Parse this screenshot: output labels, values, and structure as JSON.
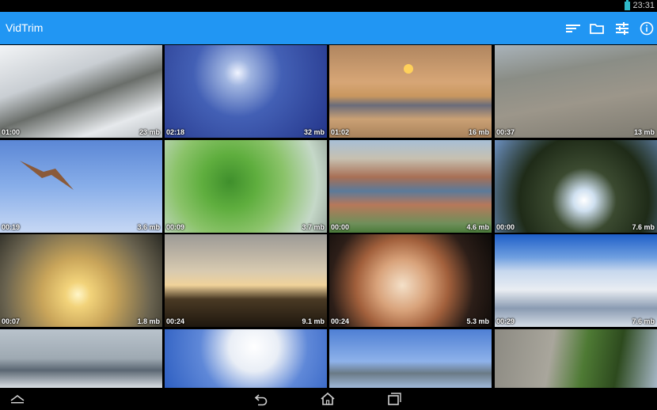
{
  "status_bar": {
    "time": "23:31"
  },
  "app_bar": {
    "title": "VidTrim",
    "actions": [
      "sort-icon",
      "folder-icon",
      "filter-settings-icon",
      "info-icon"
    ]
  },
  "videos": [
    {
      "duration": "01:00",
      "size": "23 mb"
    },
    {
      "duration": "02:18",
      "size": "32 mb"
    },
    {
      "duration": "01:02",
      "size": "16 mb"
    },
    {
      "duration": "00:37",
      "size": "13 mb"
    },
    {
      "duration": "00:19",
      "size": "3.6 mb"
    },
    {
      "duration": "00:09",
      "size": "3.7 mb"
    },
    {
      "duration": "00:00",
      "size": "4.6 mb"
    },
    {
      "duration": "00:00",
      "size": "7.6 mb"
    },
    {
      "duration": "00:07",
      "size": "1.8 mb"
    },
    {
      "duration": "00:24",
      "size": "9.1 mb"
    },
    {
      "duration": "00:24",
      "size": "5.3 mb"
    },
    {
      "duration": "00:29",
      "size": "7.6 mb"
    },
    {
      "duration": "",
      "size": ""
    },
    {
      "duration": "",
      "size": ""
    },
    {
      "duration": "",
      "size": ""
    },
    {
      "duration": "",
      "size": ""
    }
  ],
  "nav_bar": {
    "buttons": [
      "collapse-icon",
      "back-icon",
      "home-icon",
      "recent-apps-icon"
    ]
  },
  "colors": {
    "app_bar": "#2196f3",
    "status_bar": "#000000",
    "nav_bar": "#000000"
  }
}
